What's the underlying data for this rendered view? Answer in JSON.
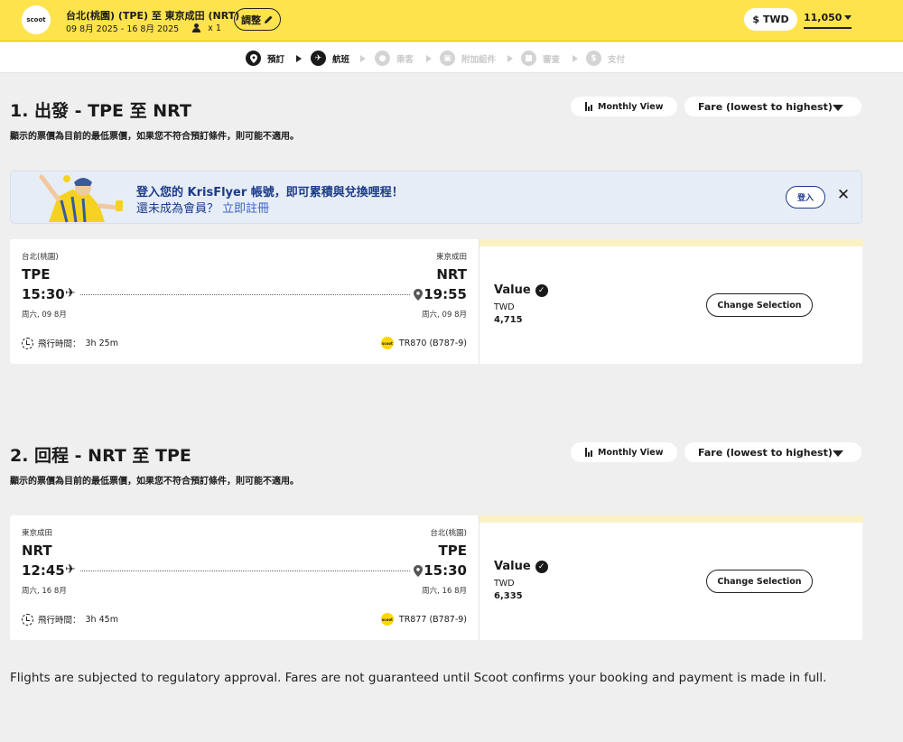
{
  "header": {
    "logo_text": "scoot",
    "route_title": "台北(桃園) (TPE) 至 東京成田 (NRT)",
    "dates": "09 8月 2025 - 16 8月 2025",
    "pax": "x 1",
    "adjust_label": "調整",
    "currency": "$ TWD",
    "total": "11,050"
  },
  "steps": [
    {
      "label": "預訂",
      "icon": "pin-icon",
      "active": true
    },
    {
      "label": "航班",
      "icon": "plane-icon",
      "active": true
    },
    {
      "label": "乘客",
      "icon": "people-icon",
      "active": false
    },
    {
      "label": "附加組件",
      "icon": "cart-icon",
      "active": false
    },
    {
      "label": "審查",
      "icon": "lock-icon",
      "active": false
    },
    {
      "label": "支付",
      "icon": "dollar-icon",
      "active": false
    }
  ],
  "outbound": {
    "title": "1. 出發 - TPE 至 NRT",
    "note": "顯示的票價為目前的最低票價，如果您不符合預訂條件，則可能不適用。",
    "monthly_view": "Monthly View",
    "sort": "Fare (lowest to highest)",
    "flight": {
      "dep_city": "台北(桃園)",
      "dep_code": "TPE",
      "dep_time": "15:30",
      "dep_date": "周六, 09 8月",
      "arr_city": "東京成田",
      "arr_code": "NRT",
      "arr_time": "19:55",
      "arr_date": "周六, 09 8月",
      "duration_label": "飛行時間：",
      "duration": "3h 25m",
      "flight_no": "TR870 (B787-9)"
    },
    "fare": {
      "name": "Value",
      "currency": "TWD",
      "amount": "4,715",
      "change_label": "Change Selection"
    }
  },
  "banner": {
    "line1": "登入您的 KrisFlyer 帳號，即可累積與兌換哩程！",
    "line2_prefix": "還未成為會員？",
    "line2_link": "立即註冊",
    "login_label": "登入",
    "close_label": "✕"
  },
  "inbound": {
    "title": "2. 回程 - NRT 至 TPE",
    "note": "顯示的票價為目前的最低票價，如果您不符合預訂條件，則可能不適用。",
    "monthly_view": "Monthly View",
    "sort": "Fare (lowest to highest)",
    "flight": {
      "dep_city": "東京成田",
      "dep_code": "NRT",
      "dep_time": "12:45",
      "dep_date": "周六, 16 8月",
      "arr_city": "台北(桃園)",
      "arr_code": "TPE",
      "arr_time": "15:30",
      "arr_date": "周六, 16 8月",
      "duration_label": "飛行時間：",
      "duration": "3h 45m",
      "flight_no": "TR877 (B787-9)"
    },
    "fare": {
      "name": "Value",
      "currency": "TWD",
      "amount": "6,335",
      "change_label": "Change Selection"
    }
  },
  "disclaimer": "Flights are subjected to regulatory approval. Fares are not guaranteed until Scoot confirms your booking and payment is made in full.",
  "colors": {
    "brand_yellow": "#ffe34c",
    "fare_strip": "#faf2c6",
    "banner_bg": "#e7edf6",
    "banner_text": "#1b3b8a"
  }
}
